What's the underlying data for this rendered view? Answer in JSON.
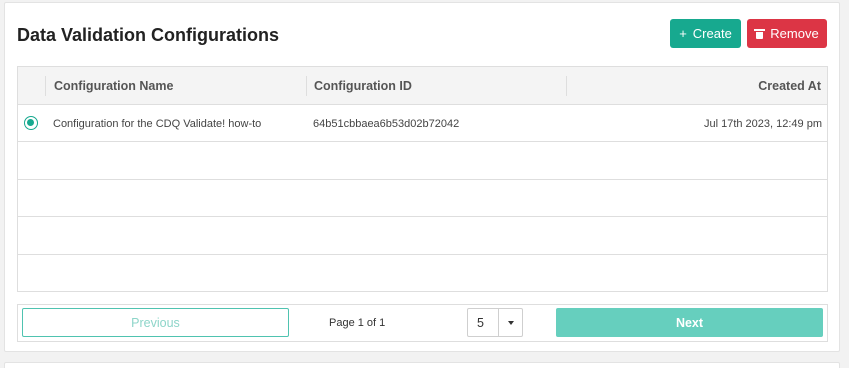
{
  "header": {
    "title": "Data Validation Configurations",
    "create_label": "Create",
    "remove_label": "Remove",
    "create_icon": "plus-icon",
    "remove_icon": "trash-icon"
  },
  "table": {
    "columns": [
      "Configuration Name",
      "Configuration ID",
      "Created At"
    ],
    "rows": [
      {
        "selected": true,
        "name": "Configuration for the CDQ Validate! how-to",
        "id": "64b51cbbaea6b53d02b72042",
        "created_at": "Jul 17th 2023, 12:49 pm"
      }
    ]
  },
  "pagination": {
    "previous_label": "Previous",
    "page_info": "Page 1 of 1",
    "page_size": "5",
    "next_label": "Next"
  },
  "colors": {
    "accent": "#17a98f",
    "danger": "#dc3545",
    "next_disabled": "#66cfbe"
  }
}
